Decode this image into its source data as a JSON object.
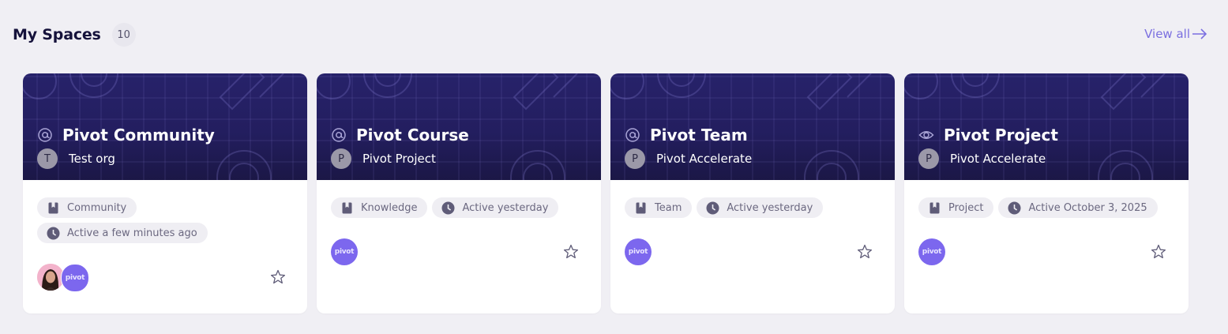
{
  "section": {
    "title": "My Spaces",
    "count": "10",
    "view_all": "View all"
  },
  "cards": [
    {
      "title": "Pivot Community",
      "title_icon": "at-icon",
      "org_initial": "T",
      "org_name": "Test org",
      "type_tag": "Community",
      "activity_tag": "Active a few minutes ago",
      "members": [
        "photo",
        "pivot"
      ],
      "avatar_text": "pivot"
    },
    {
      "title": "Pivot Course",
      "title_icon": "at-icon",
      "org_initial": "P",
      "org_name": "Pivot Project",
      "type_tag": "Knowledge",
      "activity_tag": "Active yesterday",
      "members": [
        "pivot"
      ],
      "avatar_text": "pivot"
    },
    {
      "title": "Pivot Team",
      "title_icon": "at-icon",
      "org_initial": "P",
      "org_name": "Pivot Accelerate",
      "type_tag": "Team",
      "activity_tag": "Active yesterday",
      "members": [
        "pivot"
      ],
      "avatar_text": "pivot"
    },
    {
      "title": "Pivot Project",
      "title_icon": "eye-icon",
      "org_initial": "P",
      "org_name": "Pivot Accelerate",
      "type_tag": "Project",
      "activity_tag": "Active October 3, 2025",
      "members": [
        "pivot"
      ],
      "avatar_text": "pivot"
    }
  ],
  "colors": {
    "background": "#f0eff4",
    "banner": "#231e5f",
    "accent": "#7b6fe0",
    "pivot_avatar": "#7c67ee"
  }
}
